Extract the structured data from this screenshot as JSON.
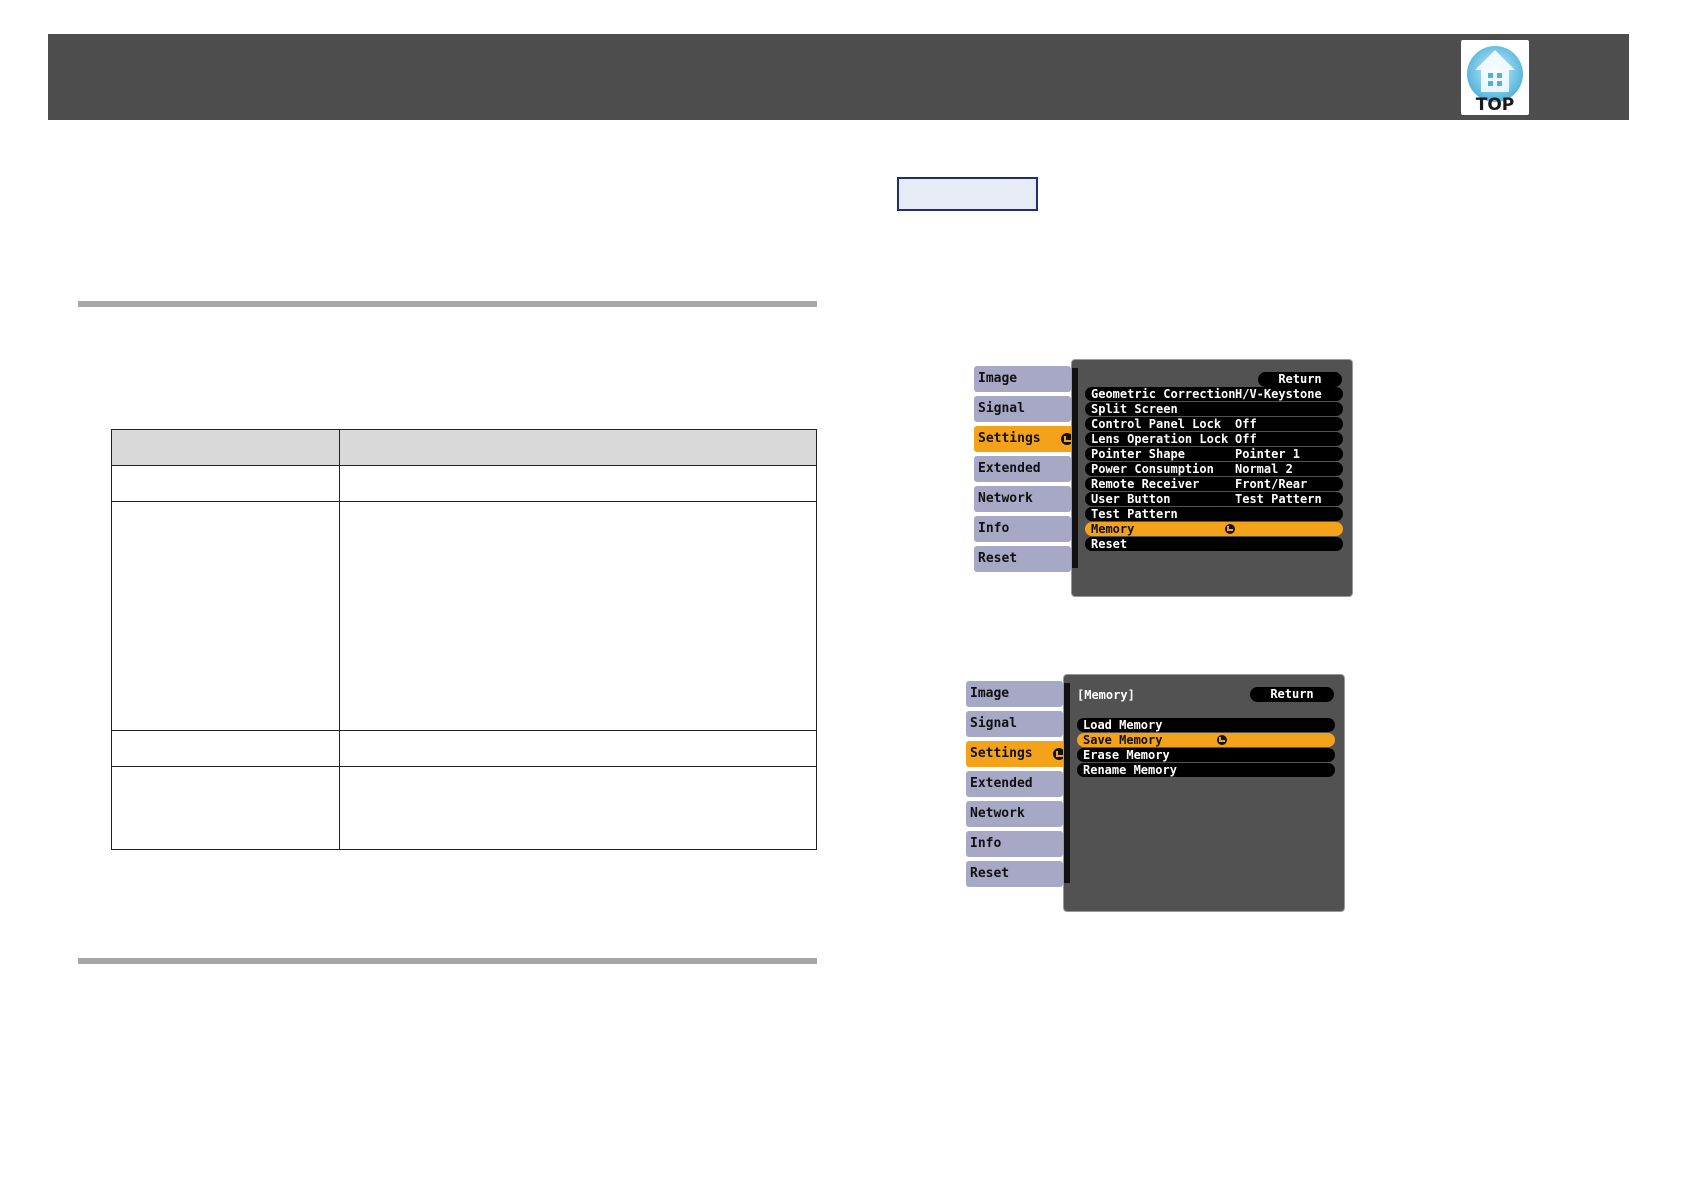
{
  "header": {
    "top_button_label": "TOP",
    "top_button_icon": "home-icon"
  },
  "menu_settings": {
    "tabs": [
      {
        "label": "Image"
      },
      {
        "label": "Signal"
      },
      {
        "label": "Settings",
        "active": true
      },
      {
        "label": "Extended"
      },
      {
        "label": "Network"
      },
      {
        "label": "Info"
      },
      {
        "label": "Reset"
      }
    ],
    "return_label": "Return",
    "rows": [
      {
        "label": "Geometric Correction",
        "value": "H/V-Keystone"
      },
      {
        "label": "Split Screen",
        "value": ""
      },
      {
        "label": "Control Panel Lock",
        "value": "Off"
      },
      {
        "label": "Lens Operation Lock",
        "value": "Off"
      },
      {
        "label": "Pointer Shape",
        "value": "Pointer 1"
      },
      {
        "label": "Power Consumption",
        "value": "Normal 2"
      },
      {
        "label": "Remote Receiver",
        "value": "Front/Rear"
      },
      {
        "label": "User Button",
        "value": "Test Pattern"
      },
      {
        "label": "Test Pattern",
        "value": ""
      },
      {
        "label": "Memory",
        "value": "",
        "selected": true
      },
      {
        "label": "Reset",
        "value": ""
      }
    ]
  },
  "menu_memory": {
    "tabs": [
      {
        "label": "Image"
      },
      {
        "label": "Signal"
      },
      {
        "label": "Settings",
        "active": true
      },
      {
        "label": "Extended"
      },
      {
        "label": "Network"
      },
      {
        "label": "Info"
      },
      {
        "label": "Reset"
      }
    ],
    "title": "[Memory]",
    "return_label": "Return",
    "rows": [
      {
        "label": "Load Memory"
      },
      {
        "label": "Save Memory",
        "selected": true
      },
      {
        "label": "Erase Memory"
      },
      {
        "label": "Rename Memory"
      }
    ]
  },
  "colors": {
    "header_band": "#4d4d4d",
    "menu_highlight": "#f5a21b",
    "tab_inactive": "#a7a7c6",
    "menu_panel": "#525252"
  }
}
